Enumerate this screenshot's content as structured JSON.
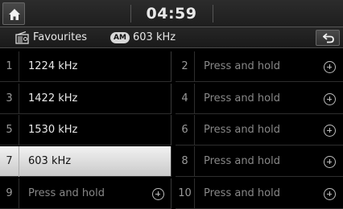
{
  "header": {
    "clock": "04:59"
  },
  "subheader": {
    "title": "Favourites",
    "band": "AM",
    "frequency": "603 kHz"
  },
  "presets": [
    {
      "number": "1",
      "label": "1224 kHz",
      "selected": false,
      "empty": false
    },
    {
      "number": "2",
      "label": "Press and hold",
      "selected": false,
      "empty": true
    },
    {
      "number": "3",
      "label": "1422 kHz",
      "selected": false,
      "empty": false
    },
    {
      "number": "4",
      "label": "Press and hold",
      "selected": false,
      "empty": true
    },
    {
      "number": "5",
      "label": "1530 kHz",
      "selected": false,
      "empty": false
    },
    {
      "number": "6",
      "label": "Press and hold",
      "selected": false,
      "empty": true
    },
    {
      "number": "7",
      "label": "603 kHz",
      "selected": true,
      "empty": false
    },
    {
      "number": "8",
      "label": "Press and hold",
      "selected": false,
      "empty": true
    },
    {
      "number": "9",
      "label": "Press and hold",
      "selected": false,
      "empty": true
    },
    {
      "number": "10",
      "label": "Press and hold",
      "selected": false,
      "empty": true
    }
  ],
  "icons": {
    "home": "home-icon",
    "radio": "radio-icon",
    "back": "back-icon",
    "add": "plus-circle-icon"
  }
}
